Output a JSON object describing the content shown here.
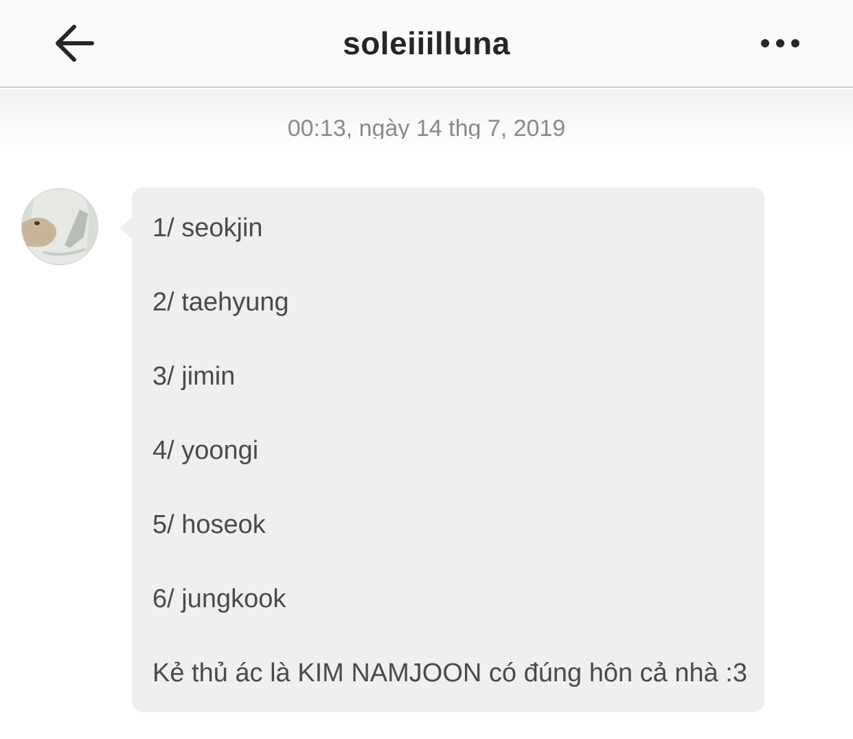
{
  "header": {
    "title": "soleiiilluna",
    "back_icon": "arrow-left-icon",
    "more_icon": "more-horizontal-icon"
  },
  "thread": {
    "timestamp": "00:13, ngày 14 thg 7, 2019",
    "avatar_icon": "user-avatar",
    "message": {
      "lines": [
        "1/ seokjin",
        "2/ taehyung",
        "3/ jimin",
        "4/ yoongi",
        "5/ hoseok",
        "6/ jungkook",
        "Kẻ thủ ác là KIM NAMJOON có đúng hôn cả nhà :3"
      ]
    }
  },
  "colors": {
    "header_bg": "#fafafa",
    "bubble_bg": "#efefef",
    "text": "#4a4a4a",
    "timestamp": "#8a8a8a"
  }
}
